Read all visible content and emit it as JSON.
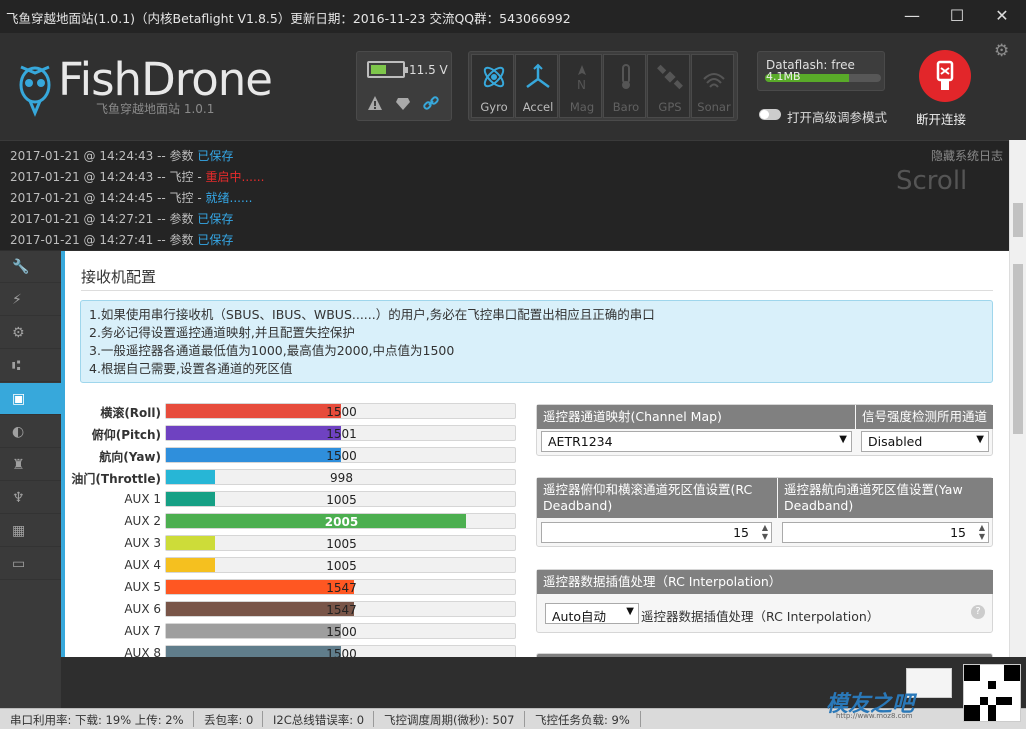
{
  "window": {
    "title": "飞鱼穿越地面站(1.0.1)（内核Betaflight V1.8.5）更新日期：2016-11-23 交流QQ群：543066992",
    "minimize": "—",
    "maximize": "☐",
    "close": "✕"
  },
  "header": {
    "logo": "FishDrone",
    "subtitle": "飞鱼穿越地面站    1.0.1",
    "voltage": "11.5 V",
    "battery_level": 0.5,
    "sensors": [
      {
        "label": "Gyro",
        "active": true
      },
      {
        "label": "Accel",
        "active": true
      },
      {
        "label": "Mag",
        "active": false
      },
      {
        "label": "Baro",
        "active": false
      },
      {
        "label": "GPS",
        "active": false
      },
      {
        "label": "Sonar",
        "active": false
      }
    ],
    "dataflash_label": "Dataflash: free",
    "dataflash_size": "4.1MB",
    "dataflash_level": 0.72,
    "advanced_toggle_label": "打开高级调参模式",
    "disconnect_label": "断开连接"
  },
  "log": {
    "hide_label": "隐藏系统日志",
    "scroll_label": "Scroll",
    "lines": [
      {
        "time": "2017-01-21 @ 14:24:43",
        "prefix": " -- 参数 ",
        "status": "已保存",
        "color": "b"
      },
      {
        "time": "2017-01-21 @ 14:24:43",
        "prefix": " -- 飞控 - ",
        "status": "重启中......",
        "color": "r"
      },
      {
        "time": "2017-01-21 @ 14:24:45",
        "prefix": " -- 飞控 - ",
        "status": "就绪......",
        "color": "b"
      },
      {
        "time": "2017-01-21 @ 14:27:21",
        "prefix": " -- 参数 ",
        "status": "已保存",
        "color": "b"
      },
      {
        "time": "2017-01-21 @ 14:27:41",
        "prefix": " -- 参数 ",
        "status": "已保存",
        "color": "b"
      }
    ]
  },
  "page": {
    "title": "接收机配置",
    "notes": [
      "1.如果使用串行接收机（SBUS、IBUS、WBUS......）的用户,务必在飞控串口配置出相应且正确的串口",
      "2.务必记得设置遥控通道映射,并且配置失控保护",
      "3.一般遥控器各通道最低值为1000,最高值为2000,中点值为1500",
      "4.根据自己需要,设置各通道的死区值"
    ]
  },
  "channels": [
    {
      "name": "横滚(Roll)",
      "value": "1500",
      "fraction": 0.5,
      "color": "#e74c3c",
      "bold": true
    },
    {
      "name": "俯仰(Pitch)",
      "value": "1501",
      "fraction": 0.5,
      "color": "#6f42c1",
      "bold": true
    },
    {
      "name": "航向(Yaw)",
      "value": "1500",
      "fraction": 0.5,
      "color": "#2f8fdc",
      "bold": true
    },
    {
      "name": "油门(Throttle)",
      "value": "998",
      "fraction": 0.14,
      "color": "#27b6d6",
      "bold": true
    },
    {
      "name": "AUX 1",
      "value": "1005",
      "fraction": 0.14,
      "color": "#16a085",
      "bold": false
    },
    {
      "name": "AUX 2",
      "value": "2005",
      "fraction": 0.86,
      "color": "#4caf50",
      "bold": false
    },
    {
      "name": "AUX 3",
      "value": "1005",
      "fraction": 0.14,
      "color": "#cddc39",
      "bold": false
    },
    {
      "name": "AUX 4",
      "value": "1005",
      "fraction": 0.14,
      "color": "#f5c01f",
      "bold": false
    },
    {
      "name": "AUX 5",
      "value": "1547",
      "fraction": 0.54,
      "color": "#ff5722",
      "bold": false
    },
    {
      "name": "AUX 6",
      "value": "1547",
      "fraction": 0.54,
      "color": "#795548",
      "bold": false
    },
    {
      "name": "AUX 7",
      "value": "1500",
      "fraction": 0.5,
      "color": "#9e9e9e",
      "bold": false
    },
    {
      "name": "AUX 8",
      "value": "1500",
      "fraction": 0.5,
      "color": "#607d8b",
      "bold": false
    }
  ],
  "channel_map": {
    "header": "遥控器通道映射(Channel Map)",
    "value": "AETR1234",
    "rssi_header": "信号强度检测所用通道",
    "rssi_value": "Disabled"
  },
  "deadband": {
    "rc_header": "遥控器俯仰和横滚通道死区值设置(RC Deadband)",
    "rc_value": "15",
    "yaw_header": "遥控器航向通道死区值设置(Yaw Deadband)",
    "yaw_value": "15"
  },
  "interpolation": {
    "header": "遥控器数据插值处理（RC Interpolation）",
    "value": "Auto自动",
    "label": "遥控器数据插值处理（RC Interpolation）"
  },
  "status_bar": {
    "port_usage": "串口利用率: 下载: 19% 上传: 2%",
    "packet_loss": "丢包率: 0",
    "i2c_errors": "I2C总线错误率: 0",
    "cycle_time": "飞控调度周期(微秒): 507",
    "cpu_load": "飞控任务负载: 9%"
  },
  "watermark": {
    "text": "模友之吧",
    "url": "http://www.moz8.com"
  }
}
